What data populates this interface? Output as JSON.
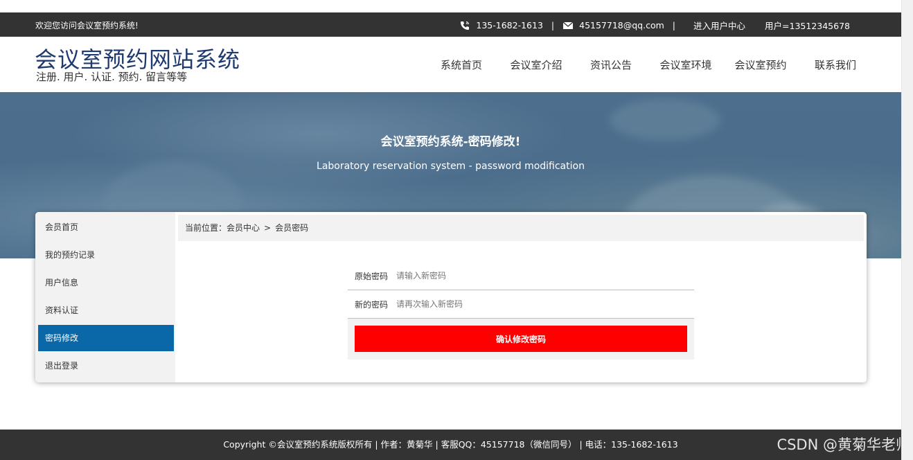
{
  "topbar": {
    "welcome": "欢迎您访问会议室预约系统!",
    "phone": "135-1682-1613",
    "email": "45157718@qq.com",
    "separator": "|",
    "user_center": "进入用户中心",
    "user_label": "用户=13512345678"
  },
  "header": {
    "title": "会议室预约网站系统",
    "subtitle": "注册. 用户. 认证. 预约. 留言等等",
    "nav": [
      "系统首页",
      "会议室介绍",
      "资讯公告",
      "会议室环境",
      "会议室预约",
      "联系我们"
    ]
  },
  "banner": {
    "title": "会议室预约系统-密码修改!",
    "subtitle": "Laboratory reservation system - password modification"
  },
  "sidebar": {
    "items": [
      "会员首页",
      "我的预约记录",
      "用户信息",
      "资料认证",
      "密码修改",
      "退出登录"
    ],
    "active_index": 4
  },
  "breadcrumb": {
    "prefix": "当前位置：",
    "level1": "会员中心",
    "arrow": ">",
    "level2": "会员密码"
  },
  "form": {
    "old_label": "原始密码",
    "old_placeholder": "请输入新密码",
    "new_label": "新的密码",
    "new_placeholder": "请再次输入新密码",
    "submit_label": "确认修改密码"
  },
  "footer": {
    "text": "Copyright ©会议室预约系统版权所有 | 作者：黄菊华 | 客服QQ：45157718（微信同号） | 电话：135-1682-1613"
  },
  "watermark": "CSDN @黄菊华老师",
  "colors": {
    "topbar_bg": "#333333",
    "title_blue": "#1f3a6e",
    "active_blue": "#0a68a8",
    "button_red": "#ff0000",
    "banner_blue": "#4d6e8c"
  }
}
